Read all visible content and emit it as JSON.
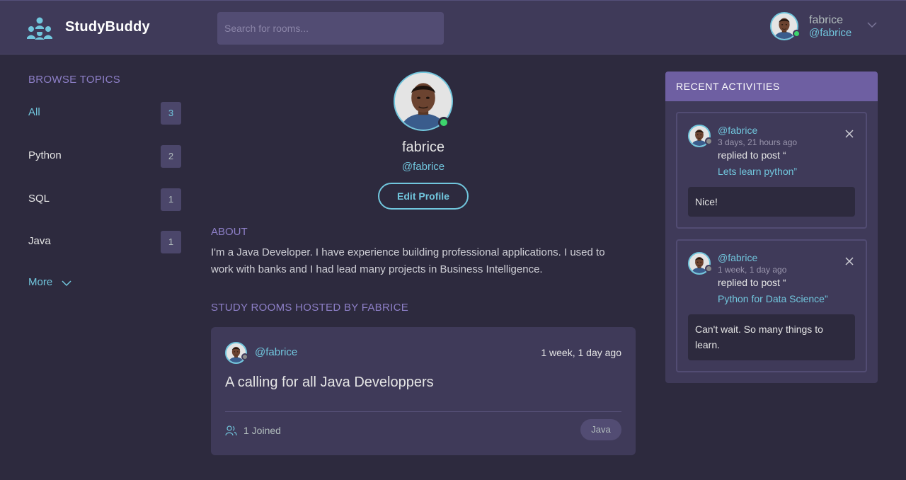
{
  "header": {
    "brand": "StudyBuddy",
    "search_placeholder": "Search for rooms...",
    "user": {
      "name": "fabrice",
      "handle": "@fabrice"
    },
    "online_color": "#3dd56d",
    "accent_color": "#71c6dd"
  },
  "sidebar": {
    "title": "BROWSE TOPICS",
    "topics": [
      {
        "label": "All",
        "count": "3",
        "active": true
      },
      {
        "label": "Python",
        "count": "2"
      },
      {
        "label": "SQL",
        "count": "1"
      },
      {
        "label": "Java",
        "count": "1"
      }
    ],
    "more_label": "More"
  },
  "profile": {
    "name": "fabrice",
    "handle": "@fabrice",
    "edit_label": "Edit Profile",
    "about_title": "ABOUT",
    "about_text": "I'm a Java Developer. I have experience building professional applications. I used to work with banks and I had lead many projects in Business Intelligence.",
    "hosted_title": "STUDY ROOMS HOSTED BY FABRICE"
  },
  "rooms": [
    {
      "host": "@fabrice",
      "time": "1 week, 1 day ago",
      "title": "A calling for all Java Developpers",
      "joined": "1 Joined",
      "topic": "Java"
    }
  ],
  "activities": {
    "title": "RECENT ACTIVITIES",
    "items": [
      {
        "user": "@fabrice",
        "time": "3 days, 21 hours ago",
        "action": "replied to post “",
        "post": "Lets learn python”",
        "message": "Nice!"
      },
      {
        "user": "@fabrice",
        "time": "1 week, 1 day ago",
        "action": "replied to post “",
        "post": "Python for Data Science”",
        "message": "Can't wait. So many things to learn."
      }
    ]
  }
}
